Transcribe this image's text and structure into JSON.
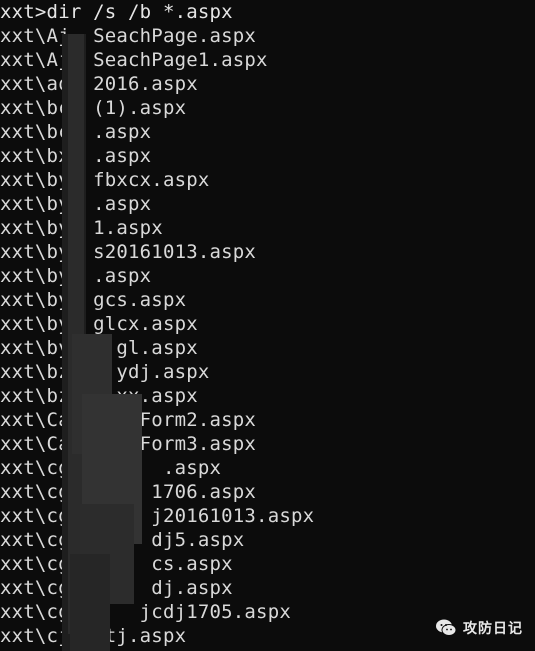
{
  "console": {
    "prompt_line": "xxt>dir /s /b *.aspx",
    "lines": [
      "xxt\\Aj  SeachPage.aspx",
      "xxt\\Aj  SeachPage1.aspx",
      "xxt\\aq  2016.aspx",
      "xxt\\bc  (1).aspx",
      "xxt\\bc  .aspx",
      "xxt\\bx  .aspx",
      "xxt\\by  fbxcx.aspx",
      "xxt\\by  .aspx",
      "xxt\\by  1.aspx",
      "xxt\\by  s20161013.aspx",
      "xxt\\by  .aspx",
      "xxt\\by  gcs.aspx",
      "xxt\\by  glcx.aspx",
      "xxt\\by    gl.aspx",
      "xxt\\bz    ydj.aspx",
      "xxt\\bz    xx.aspx",
      "xxt\\Ca      Form2.aspx",
      "xxt\\Ca      Form3.aspx",
      "xxt\\cg        .aspx",
      "xxt\\cg       1706.aspx",
      "xxt\\cg       j20161013.aspx",
      "xxt\\cg       dj5.aspx",
      "xxt\\cg       cs.aspx",
      "xxt\\cg       dj.aspx",
      "xxt\\cg      jcdj1705.aspx",
      "xxt\\cj   tj.aspx"
    ]
  },
  "watermark": {
    "label": "攻防日记",
    "icon": "wechat-icon"
  },
  "colors": {
    "background": "#0c0c0c",
    "text": "#d9d9d9"
  }
}
